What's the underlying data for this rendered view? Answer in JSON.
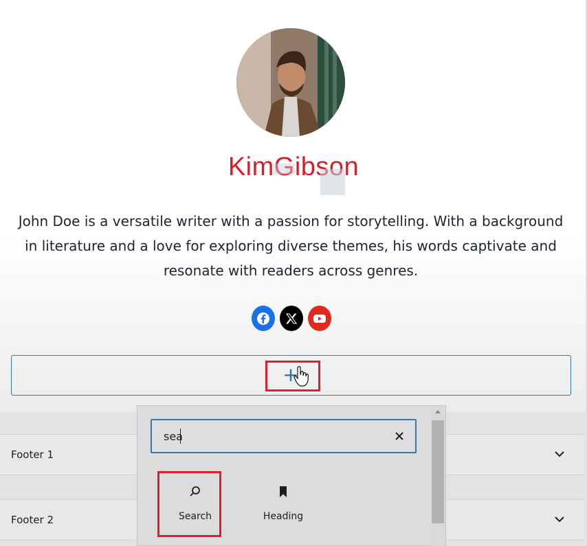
{
  "profile": {
    "name": "KimGibson",
    "bio_lines": [
      "John Doe is a versatile writer with a passion for storytelling. With a background",
      "in literature and a love for exploring diverse themes, his words captivate and",
      "resonate with readers across genres."
    ],
    "social": [
      "facebook-icon",
      "x-icon",
      "youtube-icon"
    ]
  },
  "inserter": {
    "add_button_symbol": "+"
  },
  "footers": [
    {
      "label": "Footer 1"
    },
    {
      "label": "Footer 2"
    }
  ],
  "popover": {
    "search_value": "sea",
    "blocks": [
      {
        "label": "Search",
        "icon": "search-icon"
      },
      {
        "label": "Heading",
        "icon": "bookmark-icon"
      }
    ]
  },
  "colors": {
    "name_red": "#d71f2a",
    "highlight_red": "#d7212e",
    "accent_blue": "#3476b0",
    "facebook": "#1a72e8",
    "youtube": "#e12a1f"
  }
}
